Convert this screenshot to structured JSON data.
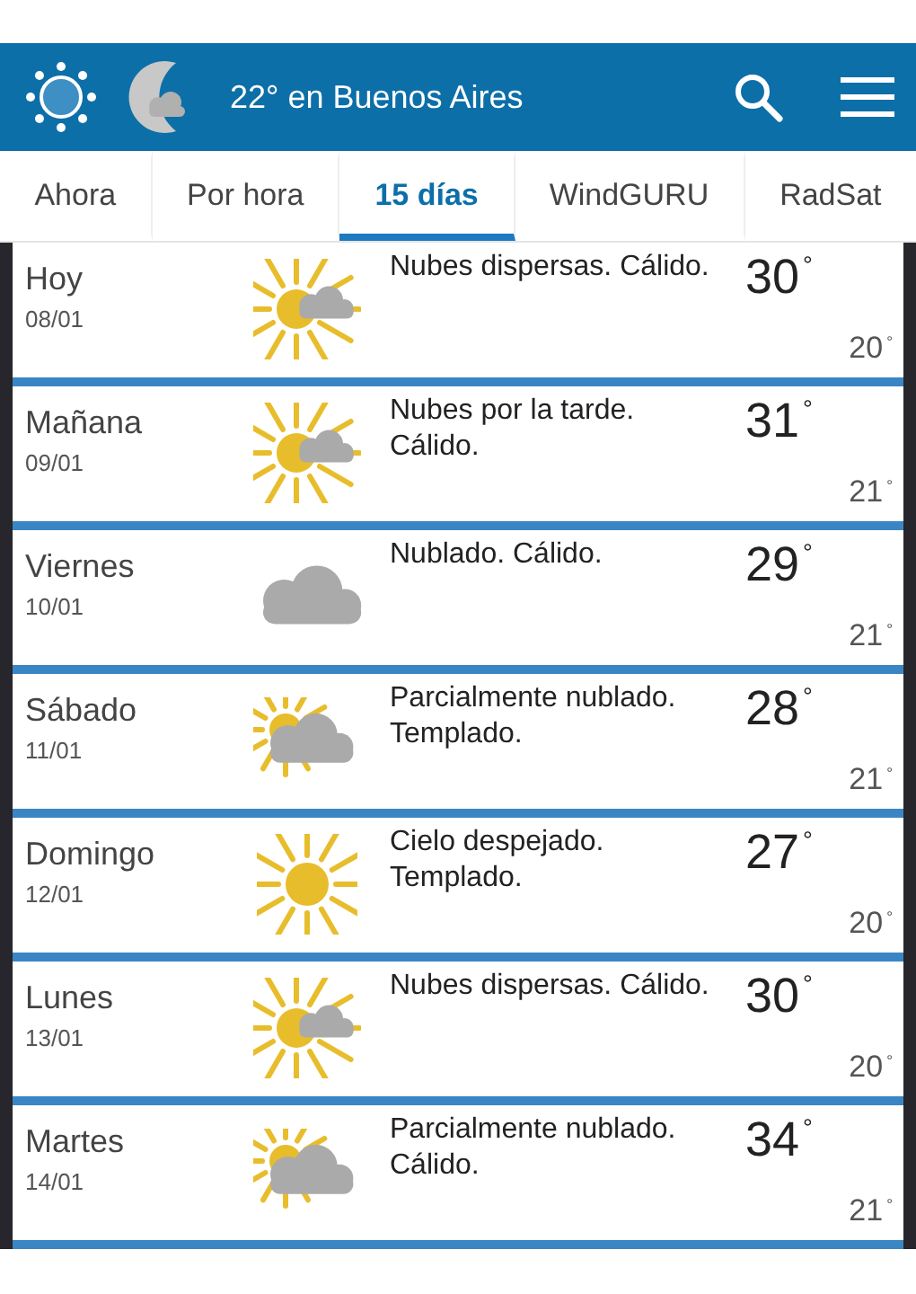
{
  "header": {
    "title": "22° en Buenos Aires"
  },
  "tabs": [
    {
      "label": "Ahora",
      "selected": false
    },
    {
      "label": "Por hora",
      "selected": false
    },
    {
      "label": "15 días",
      "selected": true
    },
    {
      "label": "WindGURU",
      "selected": false
    },
    {
      "label": "RadSat",
      "selected": false
    }
  ],
  "days": [
    {
      "day": "Hoy",
      "date": "08/01",
      "kind": "sun-cloud",
      "summary": "Nubes dispersas. Cálido.",
      "high": "30$^{°}$",
      "low": "20$^{°}$"
    },
    {
      "day": "Mañana",
      "date": "09/01",
      "kind": "sun-cloud",
      "summary": "Nubes por la tarde. Cálido.",
      "high": "31$^{°}$",
      "low": "21$^{°}$"
    },
    {
      "day": "Viernes",
      "date": "10/01",
      "kind": "cloud",
      "summary": "Nublado. Cálido.",
      "high": "29$^{°}$",
      "low": "21$^{°}$"
    },
    {
      "day": "Sábado",
      "date": "11/01",
      "kind": "partly",
      "summary": "Parcialmente nublado. Templado.",
      "high": "28$^{°}$",
      "low": "21$^{°}$"
    },
    {
      "day": "Domingo",
      "date": "12/01",
      "kind": "sun",
      "summary": "Cielo despejado. Templado.",
      "high": "27$^{°}$",
      "low": "20$^{°}$"
    },
    {
      "day": "Lunes",
      "date": "13/01",
      "kind": "sun-cloud",
      "summary": "Nubes dispersas. Cálido.",
      "high": "30$^{°}$",
      "low": "20$^{°}$"
    },
    {
      "day": "Martes",
      "date": "14/01",
      "kind": "partly",
      "summary": "Parcialmente nublado. Cálido.",
      "high": "34$^{°}$",
      "low": "21$^{°}$"
    }
  ]
}
